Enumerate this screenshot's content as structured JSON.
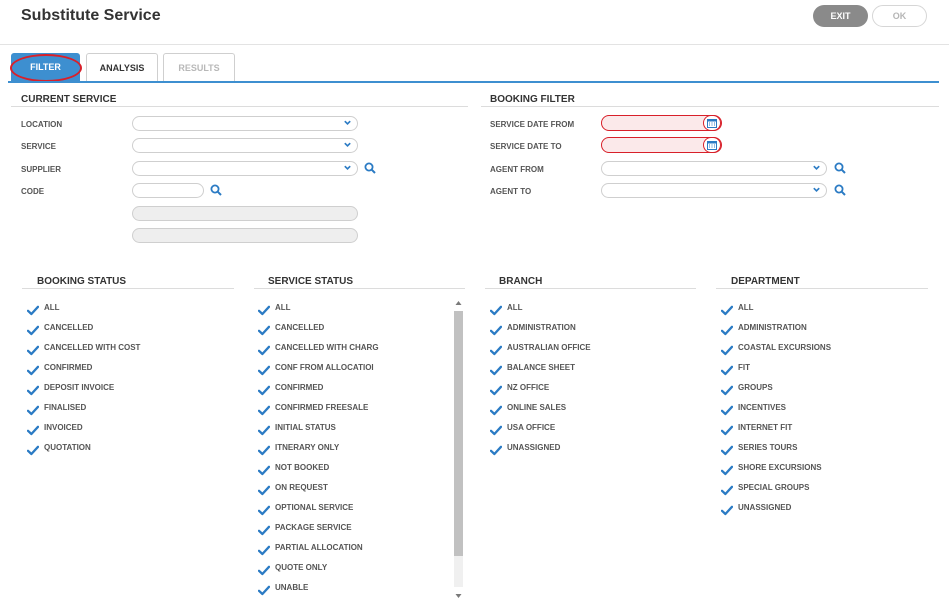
{
  "header": {
    "title": "Substitute Service",
    "exit_label": "EXIT",
    "ok_label": "OK"
  },
  "tabs": [
    {
      "label": "FILTER",
      "state": "active"
    },
    {
      "label": "ANALYSIS",
      "state": "normal"
    },
    {
      "label": "RESULTS",
      "state": "disabled"
    }
  ],
  "current_service": {
    "title": "CURRENT SERVICE",
    "location_label": "LOCATION",
    "service_label": "SERVICE",
    "supplier_label": "SUPPLIER",
    "code_label": "CODE"
  },
  "booking_filter": {
    "title": "BOOKING FILTER",
    "date_from_label": "SERVICE DATE FROM",
    "date_to_label": "SERVICE DATE TO",
    "agent_from_label": "AGENT FROM",
    "agent_to_label": "AGENT TO"
  },
  "booking_status": {
    "title": "BOOKING STATUS",
    "items": [
      "ALL",
      "CANCELLED",
      "CANCELLED WITH COST",
      "CONFIRMED",
      "DEPOSIT INVOICE",
      "FINALISED",
      "INVOICED",
      "QUOTATION"
    ]
  },
  "service_status": {
    "title": "SERVICE STATUS",
    "items": [
      "ALL",
      "CANCELLED",
      "CANCELLED WITH CHARG",
      "CONF FROM ALLOCATIOI",
      "CONFIRMED",
      "CONFIRMED FREESALE",
      "INITIAL STATUS",
      "ITNERARY ONLY",
      "NOT BOOKED",
      "ON REQUEST",
      "OPTIONAL SERVICE",
      "PACKAGE SERVICE",
      "PARTIAL ALLOCATION",
      "QUOTE ONLY",
      "UNABLE"
    ]
  },
  "branch": {
    "title": "BRANCH",
    "items": [
      "ALL",
      "ADMINISTRATION",
      "AUSTRALIAN OFFICE",
      "BALANCE SHEET",
      "NZ OFFICE",
      "ONLINE SALES",
      "USA OFFICE",
      "UNASSIGNED"
    ]
  },
  "department": {
    "title": "DEPARTMENT",
    "items": [
      "ALL",
      "ADMINISTRATION",
      "COASTAL EXCURSIONS",
      "FIT",
      "GROUPS",
      "INCENTIVES",
      "INTERNET FIT",
      "SERIES TOURS",
      "SHORE EXCURSIONS",
      "SPECIAL GROUPS",
      "UNASSIGNED"
    ]
  },
  "colors": {
    "accent": "#3d8fd0",
    "error": "#d8202a",
    "check": "#2b7bc4"
  },
  "icons": {
    "check": "checkmark-icon",
    "chevron": "chevron-down-icon",
    "search": "search-icon",
    "calendar": "calendar-icon"
  }
}
